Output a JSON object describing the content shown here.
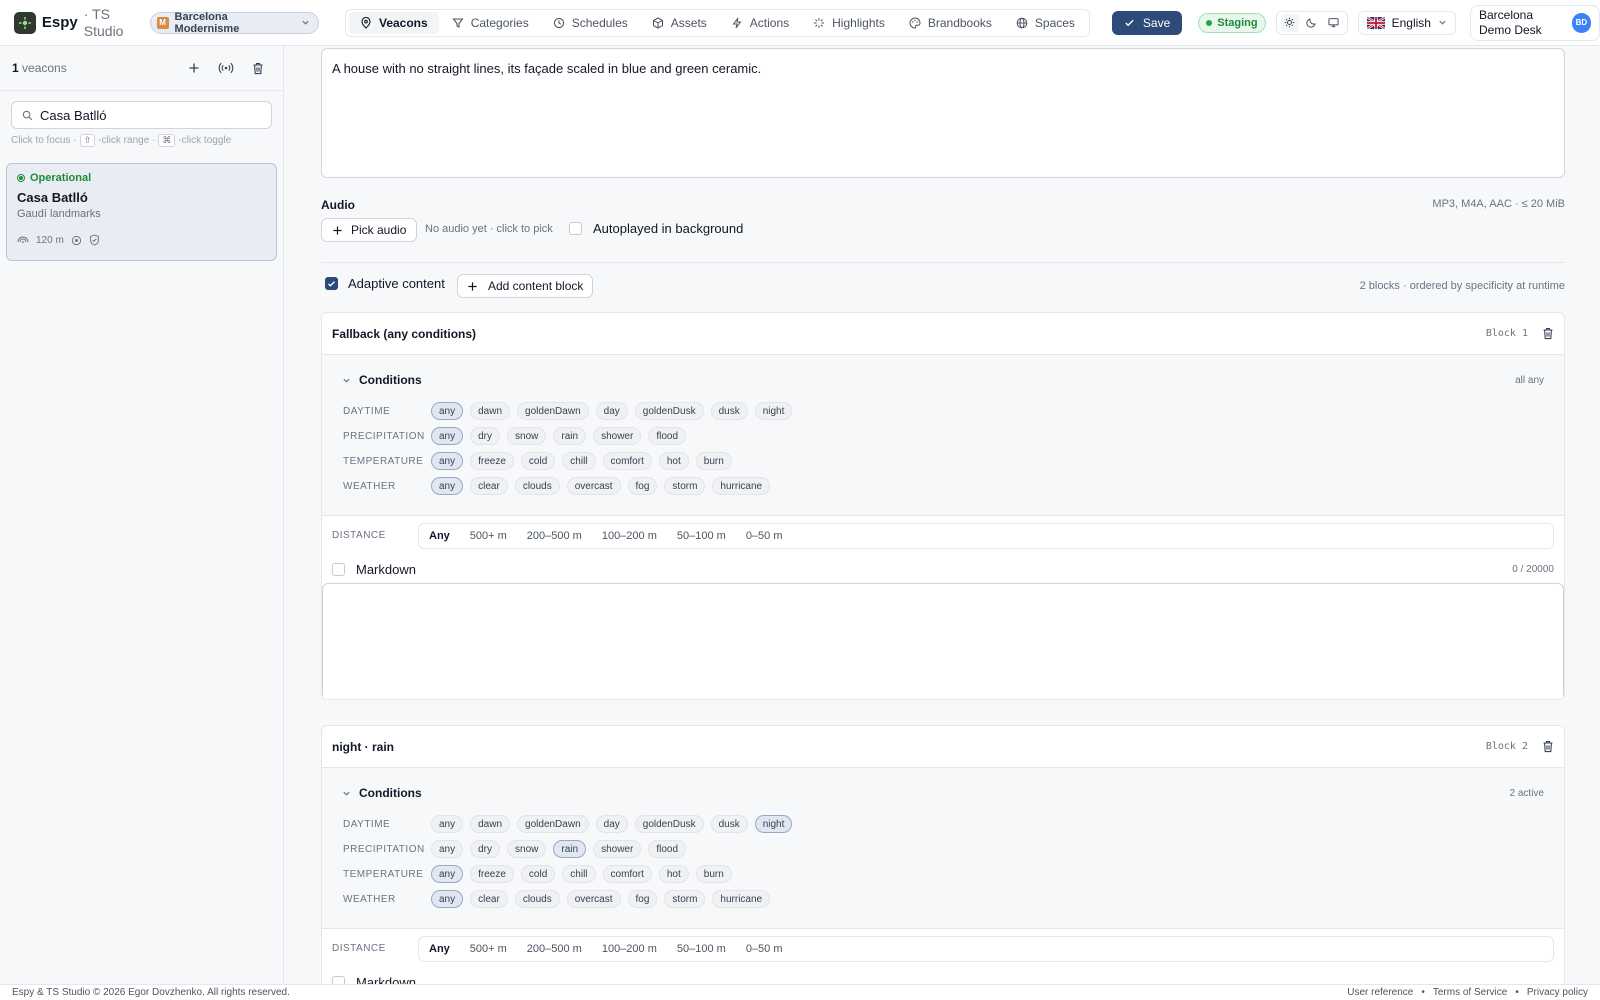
{
  "header": {
    "app_name": "Espy",
    "app_sub": "· TS Studio",
    "project": {
      "badge": "M",
      "name": "Barcelona Modernisme"
    },
    "nav": [
      {
        "label": "Veacons",
        "icon": "pin-icon",
        "active": true
      },
      {
        "label": "Categories",
        "icon": "filter-icon"
      },
      {
        "label": "Schedules",
        "icon": "clock-icon"
      },
      {
        "label": "Assets",
        "icon": "cube-icon"
      },
      {
        "label": "Actions",
        "icon": "bolt-icon"
      },
      {
        "label": "Highlights",
        "icon": "sparkle-icon"
      },
      {
        "label": "Brandbooks",
        "icon": "palette-icon"
      },
      {
        "label": "Spaces",
        "icon": "globe-icon"
      }
    ],
    "save_label": "Save",
    "env_label": "Staging",
    "language": "English",
    "user_name": "Barcelona Demo Desk",
    "user_initials": "BD"
  },
  "sidebar": {
    "count": "1",
    "count_label": "veacons",
    "search_value": "Casa Batlló",
    "hint": {
      "focus": "Click to focus ·",
      "range": "-click range ·",
      "toggle": "-click toggle",
      "range_key": "⇧",
      "toggle_key": "⌘"
    },
    "card": {
      "status": "Operational",
      "title": "Casa Batlló",
      "subtitle": "Gaudí landmarks",
      "radius": "120 m"
    }
  },
  "main": {
    "description": "A house with no straight lines, its façade scaled in blue and green ceramic.",
    "audio": {
      "label": "Audio",
      "formats": "MP3, M4A, AAC · ≤ 20 MiB",
      "pick_label": "Pick audio",
      "empty_hint": "No audio yet · click to pick",
      "autoplay_label": "Autoplayed in background"
    },
    "adaptive_label": "Adaptive content",
    "add_block_label": "Add content block",
    "blocks_info": "2 blocks · ordered by specificity at runtime",
    "conditions_label": "Conditions",
    "labels": {
      "daytime": "DAYTIME",
      "precipitation": "PRECIPITATION",
      "temperature": "TEMPERATURE",
      "weather": "WEATHER",
      "distance": "DISTANCE",
      "markdown": "Markdown"
    },
    "options": {
      "daytime": [
        "any",
        "dawn",
        "goldenDawn",
        "day",
        "goldenDusk",
        "dusk",
        "night"
      ],
      "precipitation": [
        "any",
        "dry",
        "snow",
        "rain",
        "shower",
        "flood"
      ],
      "temperature": [
        "any",
        "freeze",
        "cold",
        "chill",
        "comfort",
        "hot",
        "burn"
      ],
      "weather": [
        "any",
        "clear",
        "clouds",
        "overcast",
        "fog",
        "storm",
        "hurricane"
      ],
      "distance": [
        "Any",
        "500+ m",
        "200–500 m",
        "100–200 m",
        "50–100 m",
        "0–50 m"
      ]
    },
    "blocks": [
      {
        "title": "Fallback (any conditions)",
        "num": "Block 1",
        "state": "all any",
        "selected": {
          "daytime": "any",
          "precipitation": "any",
          "temperature": "any",
          "weather": "any"
        },
        "distance": "Any",
        "md_count": "0 / 20000"
      },
      {
        "title": "night · rain",
        "num": "Block 2",
        "state": "2 active",
        "selected": {
          "daytime": "night",
          "precipitation": "rain",
          "temperature": "any",
          "weather": "any"
        },
        "distance": "Any"
      }
    ]
  },
  "footer": {
    "copyright": "Espy & TS Studio © 2026 Egor Dovzhenko. All rights reserved.",
    "links": [
      "User reference",
      "Terms of Service",
      "Privacy policy"
    ]
  },
  "colors": {
    "accent": "#2d4a78",
    "success": "#1f8a3e"
  }
}
